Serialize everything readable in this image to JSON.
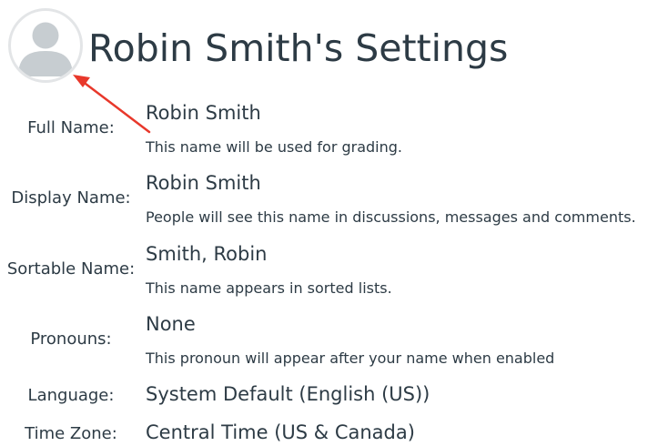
{
  "profile": {
    "title": "Robin Smith's Settings"
  },
  "fields": {
    "full_name": {
      "label": "Full Name:",
      "value": "Robin Smith",
      "hint": "This name will be used for grading."
    },
    "display_name": {
      "label": "Display Name:",
      "value": "Robin Smith",
      "hint": "People will see this name in discussions, messages and comments."
    },
    "sortable_name": {
      "label": "Sortable Name:",
      "value": "Smith, Robin",
      "hint": "This name appears in sorted lists."
    },
    "pronouns": {
      "label": "Pronouns:",
      "value": "None",
      "hint": "This pronoun will appear after your name when enabled"
    },
    "language": {
      "label": "Language:",
      "value": "System Default (English (US))"
    },
    "time_zone": {
      "label": "Time Zone:",
      "value": "Central Time (US & Canada)"
    }
  },
  "colors": {
    "annotation_arrow": "#e8382b",
    "avatar_fill": "#c7cdd1",
    "text": "#2d3b45"
  },
  "icons": {
    "avatar": "user-silhouette-icon",
    "annotation": "arrow-icon"
  }
}
